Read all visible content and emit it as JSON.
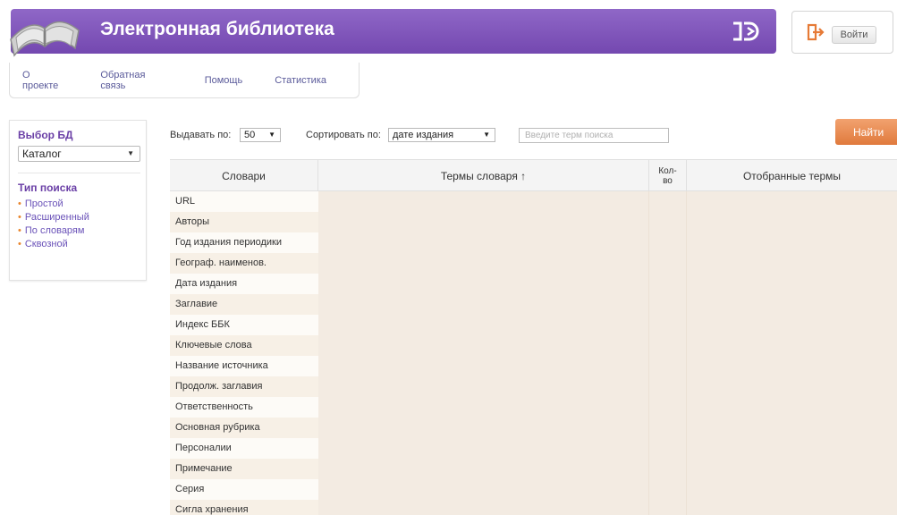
{
  "header": {
    "title": "Электронная библиотека",
    "accent_color": "#7a4fb5"
  },
  "login": {
    "label": "Войти"
  },
  "topnav": {
    "items": [
      "О проекте",
      "Обратная связь",
      "Помощь",
      "Статистика"
    ]
  },
  "sidebar": {
    "db_heading": "Выбор БД",
    "db_selected": "Каталог",
    "search_type_heading": "Тип поиска",
    "search_types": [
      "Простой",
      "Расширенный",
      "По словарям",
      "Сквозной"
    ]
  },
  "toolbar": {
    "per_page_label": "Выдавать по:",
    "per_page_value": "50",
    "sort_label": "Сортировать по:",
    "sort_value": "дате издания",
    "search_placeholder": "Введите терм поиска",
    "find_label": "Найти"
  },
  "table": {
    "headers": {
      "dictionaries": "Словари",
      "terms": "Термы словаря ↑",
      "count": "Кол-\nво",
      "selected": "Отобранные термы"
    },
    "dictionaries": [
      "URL",
      "Авторы",
      "Год издания периодики",
      "Географ. наименов.",
      "Дата издания",
      "Заглавие",
      "Индекс ББК",
      "Ключевые слова",
      "Название источника",
      "Продолж. заглавия",
      "Ответственность",
      "Основная рубрика",
      "Персоналии",
      "Примечание",
      "Серия",
      "Сигла хранения"
    ]
  }
}
